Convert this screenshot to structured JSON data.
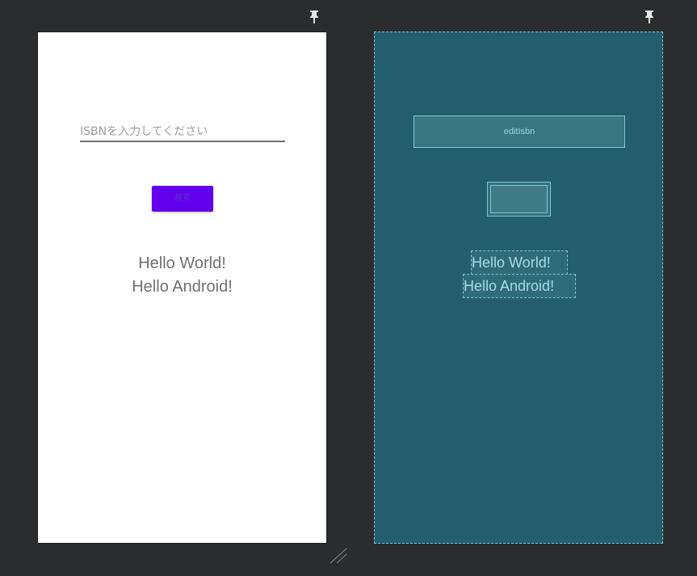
{
  "design_view": {
    "edit_field": {
      "placeholder": "ISBNを入力してください"
    },
    "search_button": {
      "label": "検索"
    },
    "hello_world": "Hello World!",
    "hello_android": "Hello Android!"
  },
  "blueprint_view": {
    "edit_field_id": "editIsbn",
    "hello_world": "Hello World!",
    "hello_android": "Hello Android!"
  },
  "icons": {
    "pin": "pin-icon",
    "resize": "resize-handle-icon"
  },
  "colors": {
    "background": "#2b2c2e",
    "button": "#6200ee",
    "blueprint": "#245d6d",
    "blueprint_outline": "#7fc9d9"
  }
}
